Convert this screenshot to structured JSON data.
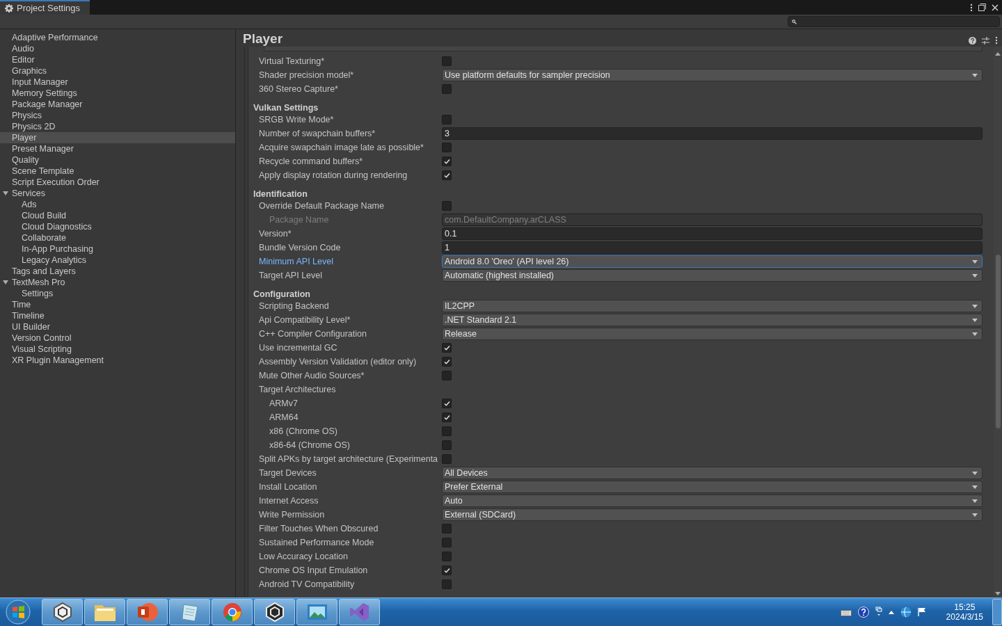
{
  "window": {
    "tab_title": "Project Settings"
  },
  "sidebar": {
    "items": [
      {
        "label": "Adaptive Performance",
        "selected": false
      },
      {
        "label": "Audio",
        "selected": false
      },
      {
        "label": "Editor",
        "selected": false
      },
      {
        "label": "Graphics",
        "selected": false
      },
      {
        "label": "Input Manager",
        "selected": false
      },
      {
        "label": "Memory Settings",
        "selected": false
      },
      {
        "label": "Package Manager",
        "selected": false
      },
      {
        "label": "Physics",
        "selected": false
      },
      {
        "label": "Physics 2D",
        "selected": false
      },
      {
        "label": "Player",
        "selected": true
      },
      {
        "label": "Preset Manager",
        "selected": false
      },
      {
        "label": "Quality",
        "selected": false
      },
      {
        "label": "Scene Template",
        "selected": false
      },
      {
        "label": "Script Execution Order",
        "selected": false
      },
      {
        "label": "Services",
        "selected": false,
        "expanded": true,
        "children": [
          {
            "label": "Ads",
            "selected": false
          },
          {
            "label": "Cloud Build",
            "selected": false
          },
          {
            "label": "Cloud Diagnostics",
            "selected": false
          },
          {
            "label": "Collaborate",
            "selected": false
          },
          {
            "label": "In-App Purchasing",
            "selected": false
          },
          {
            "label": "Legacy Analytics",
            "selected": false
          }
        ]
      },
      {
        "label": "Tags and Layers",
        "selected": false
      },
      {
        "label": "TextMesh Pro",
        "selected": false,
        "expanded": true,
        "children": [
          {
            "label": "Settings",
            "selected": false
          }
        ]
      },
      {
        "label": "Time",
        "selected": false
      },
      {
        "label": "Timeline",
        "selected": false
      },
      {
        "label": "UI Builder",
        "selected": false
      },
      {
        "label": "Version Control",
        "selected": false
      },
      {
        "label": "Visual Scripting",
        "selected": false
      },
      {
        "label": "XR Plugin Management",
        "selected": false
      }
    ]
  },
  "page_title": "Player",
  "sections": [
    {
      "rows": [
        {
          "kind": "checkbox",
          "label": "Virtual Texturing*",
          "checked": false
        },
        {
          "kind": "dropdown",
          "label": "Shader precision model*",
          "value": "Use platform defaults for sampler precision"
        },
        {
          "kind": "checkbox",
          "label": "360 Stereo Capture*",
          "checked": false
        }
      ]
    },
    {
      "title": "Vulkan Settings",
      "rows": [
        {
          "kind": "checkbox",
          "label": "SRGB Write Mode*",
          "checked": false
        },
        {
          "kind": "text",
          "label": "Number of swapchain buffers*",
          "value": "3"
        },
        {
          "kind": "checkbox",
          "label": "Acquire swapchain image late as possible*",
          "checked": false
        },
        {
          "kind": "checkbox",
          "label": "Recycle command buffers*",
          "checked": true
        },
        {
          "kind": "checkbox",
          "label": "Apply display rotation during rendering",
          "checked": true
        }
      ]
    },
    {
      "title": "Identification",
      "rows": [
        {
          "kind": "checkbox",
          "label": "Override Default Package Name",
          "checked": false,
          "children": [
            {
              "kind": "text",
              "label": "Package Name",
              "value": "com.DefaultCompany.arCLASS",
              "disabled": true
            }
          ]
        },
        {
          "kind": "text",
          "label": "Version*",
          "value": "0.1"
        },
        {
          "kind": "text",
          "label": "Bundle Version Code",
          "value": "1"
        },
        {
          "kind": "dropdown",
          "label": "Minimum API Level",
          "value": "Android 8.0 'Oreo' (API level 26)",
          "focused": true
        },
        {
          "kind": "dropdown",
          "label": "Target API Level",
          "value": "Automatic (highest installed)"
        }
      ]
    },
    {
      "title": "Configuration",
      "rows": [
        {
          "kind": "dropdown",
          "label": "Scripting Backend",
          "value": "IL2CPP"
        },
        {
          "kind": "dropdown",
          "label": "Api Compatibility Level*",
          "value": ".NET Standard 2.1"
        },
        {
          "kind": "dropdown",
          "label": "C++ Compiler Configuration",
          "value": "Release"
        },
        {
          "kind": "checkbox",
          "label": "Use incremental GC",
          "checked": true
        },
        {
          "kind": "checkbox",
          "label": "Assembly Version Validation (editor only)",
          "checked": true
        },
        {
          "kind": "checkbox",
          "label": "Mute Other Audio Sources*",
          "checked": false
        },
        {
          "kind": "label",
          "label": "Target Architectures",
          "children": [
            {
              "kind": "checkbox",
              "label": "ARMv7",
              "checked": true
            },
            {
              "kind": "checkbox",
              "label": "ARM64",
              "checked": true
            },
            {
              "kind": "checkbox",
              "label": "x86 (Chrome OS)",
              "checked": false
            },
            {
              "kind": "checkbox",
              "label": "x86-64 (Chrome OS)",
              "checked": false
            }
          ]
        },
        {
          "kind": "checkbox",
          "label": "Split APKs by target architecture (Experimenta",
          "checked": false
        },
        {
          "kind": "dropdown",
          "label": "Target Devices",
          "value": "All Devices"
        },
        {
          "kind": "dropdown",
          "label": "Install Location",
          "value": "Prefer External"
        },
        {
          "kind": "dropdown",
          "label": "Internet Access",
          "value": "Auto"
        },
        {
          "kind": "dropdown",
          "label": "Write Permission",
          "value": "External (SDCard)"
        },
        {
          "kind": "checkbox",
          "label": "Filter Touches When Obscured",
          "checked": false
        },
        {
          "kind": "checkbox",
          "label": "Sustained Performance Mode",
          "checked": false
        },
        {
          "kind": "checkbox",
          "label": "Low Accuracy Location",
          "checked": false
        },
        {
          "kind": "checkbox",
          "label": "Chrome OS Input Emulation",
          "checked": true
        },
        {
          "kind": "checkbox",
          "label": "Android TV Compatibility",
          "checked": false
        }
      ]
    }
  ],
  "taskbar": {
    "time": "15:25",
    "date": "2024/3/15"
  }
}
